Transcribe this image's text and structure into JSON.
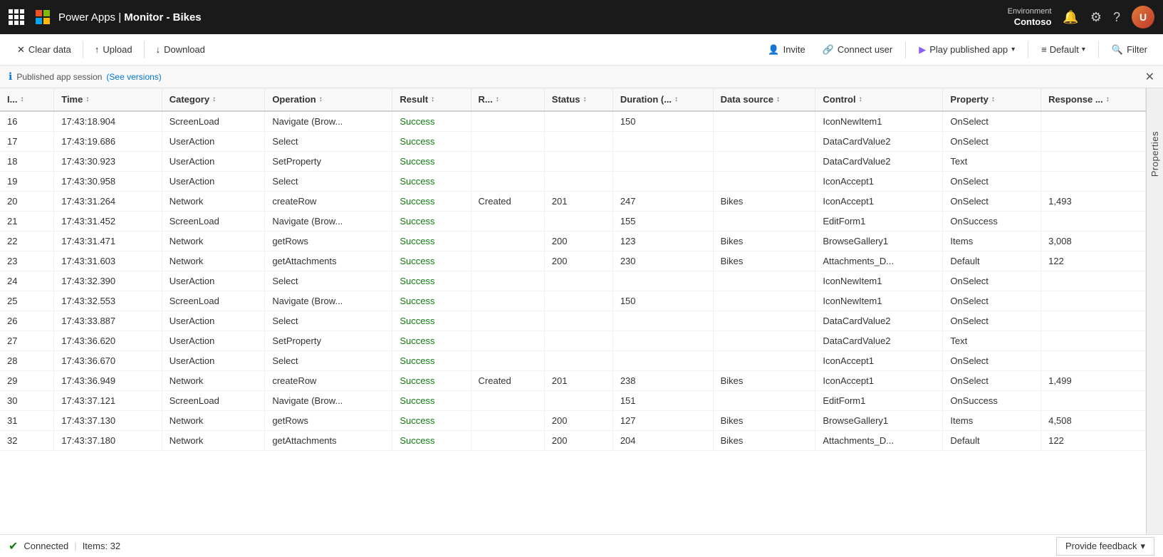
{
  "topbar": {
    "app_name": "Power Apps",
    "separator": "|",
    "monitor_title": "Monitor - Bikes",
    "environment_label": "Environment",
    "environment_name": "Contoso"
  },
  "toolbar": {
    "clear_data": "Clear data",
    "upload": "Upload",
    "download": "Download",
    "invite": "Invite",
    "connect_user": "Connect user",
    "play_published_app": "Play published app",
    "default": "Default",
    "filter": "Filter"
  },
  "session_bar": {
    "text": "Published app session",
    "link_text": "(See versions)"
  },
  "table": {
    "columns": [
      {
        "id": "id",
        "label": "I...",
        "class": "col-id"
      },
      {
        "id": "time",
        "label": "Time",
        "class": "col-time"
      },
      {
        "id": "category",
        "label": "Category",
        "class": "col-cat"
      },
      {
        "id": "operation",
        "label": "Operation",
        "class": "col-op"
      },
      {
        "id": "result",
        "label": "Result",
        "class": "col-res"
      },
      {
        "id": "r",
        "label": "R...",
        "class": "col-r"
      },
      {
        "id": "status",
        "label": "Status",
        "class": "col-status"
      },
      {
        "id": "duration",
        "label": "Duration (...",
        "class": "col-dur"
      },
      {
        "id": "datasource",
        "label": "Data source",
        "class": "col-ds"
      },
      {
        "id": "control",
        "label": "Control",
        "class": "col-ctrl"
      },
      {
        "id": "property",
        "label": "Property",
        "class": "col-prop"
      },
      {
        "id": "response",
        "label": "Response ...",
        "class": "col-resp"
      }
    ],
    "rows": [
      {
        "id": 16,
        "time": "17:43:18.904",
        "category": "ScreenLoad",
        "operation": "Navigate (Brow...",
        "result": "Success",
        "r": "",
        "status": "",
        "duration": "150",
        "datasource": "",
        "control": "IconNewItem1",
        "property": "OnSelect",
        "response": ""
      },
      {
        "id": 17,
        "time": "17:43:19.686",
        "category": "UserAction",
        "operation": "Select",
        "result": "Success",
        "r": "",
        "status": "",
        "duration": "",
        "datasource": "",
        "control": "DataCardValue2",
        "property": "OnSelect",
        "response": ""
      },
      {
        "id": 18,
        "time": "17:43:30.923",
        "category": "UserAction",
        "operation": "SetProperty",
        "result": "Success",
        "r": "",
        "status": "",
        "duration": "",
        "datasource": "",
        "control": "DataCardValue2",
        "property": "Text",
        "response": ""
      },
      {
        "id": 19,
        "time": "17:43:30.958",
        "category": "UserAction",
        "operation": "Select",
        "result": "Success",
        "r": "",
        "status": "",
        "duration": "",
        "datasource": "",
        "control": "IconAccept1",
        "property": "OnSelect",
        "response": ""
      },
      {
        "id": 20,
        "time": "17:43:31.264",
        "category": "Network",
        "operation": "createRow",
        "result": "Success",
        "r": "Created",
        "status": "201",
        "duration": "247",
        "datasource": "Bikes",
        "control": "IconAccept1",
        "property": "OnSelect",
        "response": "1,493"
      },
      {
        "id": 21,
        "time": "17:43:31.452",
        "category": "ScreenLoad",
        "operation": "Navigate (Brow...",
        "result": "Success",
        "r": "",
        "status": "",
        "duration": "155",
        "datasource": "",
        "control": "EditForm1",
        "property": "OnSuccess",
        "response": ""
      },
      {
        "id": 22,
        "time": "17:43:31.471",
        "category": "Network",
        "operation": "getRows",
        "result": "Success",
        "r": "",
        "status": "200",
        "duration": "123",
        "datasource": "Bikes",
        "control": "BrowseGallery1",
        "property": "Items",
        "response": "3,008"
      },
      {
        "id": 23,
        "time": "17:43:31.603",
        "category": "Network",
        "operation": "getAttachments",
        "result": "Success",
        "r": "",
        "status": "200",
        "duration": "230",
        "datasource": "Bikes",
        "control": "Attachments_D...",
        "property": "Default",
        "response": "122"
      },
      {
        "id": 24,
        "time": "17:43:32.390",
        "category": "UserAction",
        "operation": "Select",
        "result": "Success",
        "r": "",
        "status": "",
        "duration": "",
        "datasource": "",
        "control": "IconNewItem1",
        "property": "OnSelect",
        "response": ""
      },
      {
        "id": 25,
        "time": "17:43:32.553",
        "category": "ScreenLoad",
        "operation": "Navigate (Brow...",
        "result": "Success",
        "r": "",
        "status": "",
        "duration": "150",
        "datasource": "",
        "control": "IconNewItem1",
        "property": "OnSelect",
        "response": ""
      },
      {
        "id": 26,
        "time": "17:43:33.887",
        "category": "UserAction",
        "operation": "Select",
        "result": "Success",
        "r": "",
        "status": "",
        "duration": "",
        "datasource": "",
        "control": "DataCardValue2",
        "property": "OnSelect",
        "response": ""
      },
      {
        "id": 27,
        "time": "17:43:36.620",
        "category": "UserAction",
        "operation": "SetProperty",
        "result": "Success",
        "r": "",
        "status": "",
        "duration": "",
        "datasource": "",
        "control": "DataCardValue2",
        "property": "Text",
        "response": ""
      },
      {
        "id": 28,
        "time": "17:43:36.670",
        "category": "UserAction",
        "operation": "Select",
        "result": "Success",
        "r": "",
        "status": "",
        "duration": "",
        "datasource": "",
        "control": "IconAccept1",
        "property": "OnSelect",
        "response": ""
      },
      {
        "id": 29,
        "time": "17:43:36.949",
        "category": "Network",
        "operation": "createRow",
        "result": "Success",
        "r": "Created",
        "status": "201",
        "duration": "238",
        "datasource": "Bikes",
        "control": "IconAccept1",
        "property": "OnSelect",
        "response": "1,499"
      },
      {
        "id": 30,
        "time": "17:43:37.121",
        "category": "ScreenLoad",
        "operation": "Navigate (Brow...",
        "result": "Success",
        "r": "",
        "status": "",
        "duration": "151",
        "datasource": "",
        "control": "EditForm1",
        "property": "OnSuccess",
        "response": ""
      },
      {
        "id": 31,
        "time": "17:43:37.130",
        "category": "Network",
        "operation": "getRows",
        "result": "Success",
        "r": "",
        "status": "200",
        "duration": "127",
        "datasource": "Bikes",
        "control": "BrowseGallery1",
        "property": "Items",
        "response": "4,508"
      },
      {
        "id": 32,
        "time": "17:43:37.180",
        "category": "Network",
        "operation": "getAttachments",
        "result": "Success",
        "r": "",
        "status": "200",
        "duration": "204",
        "datasource": "Bikes",
        "control": "Attachments_D...",
        "property": "Default",
        "response": "122"
      }
    ]
  },
  "properties_panel": {
    "label": "Properties"
  },
  "status_bar": {
    "connected_label": "Connected",
    "items_label": "Items: 32",
    "feedback_btn": "Provide feedback"
  }
}
